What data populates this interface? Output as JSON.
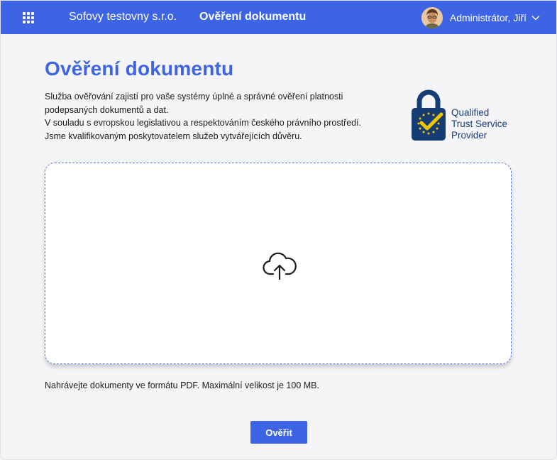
{
  "header": {
    "company": "Sofovy testovny s.r.o.",
    "nav_title": "Ověření dokumentu",
    "user_name": "Administrátor, Jiří",
    "bg_color": "#3e64e6"
  },
  "main": {
    "title": "Ověření dokumentu",
    "description": [
      "Služba ověřování zajistí pro vaše systémy úplné a správné ověření platnosti",
      "podepsaných dokumentů a dat.",
      "V souladu s evropskou legislativou a respektováním českého právního prostředí.",
      "Jsme kvalifikovaným poskytovatelem služeb vytvářejících důvěru."
    ],
    "badge": {
      "line1": "Qualified",
      "line2": "Trust Service",
      "line3": "Provider"
    },
    "dropzone_icon": "cloud-upload-icon",
    "hint": "Nahrávejte dokumenty ve formátu PDF. Maximální velikost je 100 MB.",
    "verify_label": "Ověřit"
  }
}
